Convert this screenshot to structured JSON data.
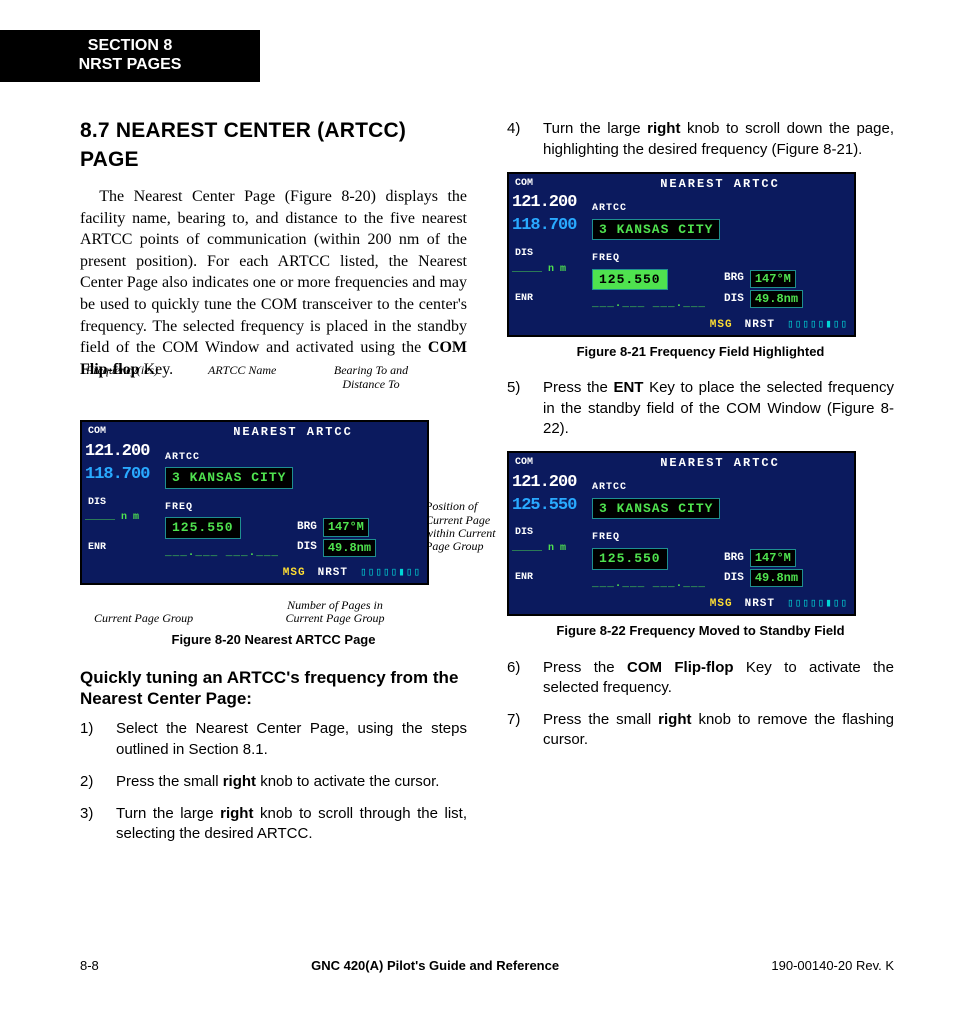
{
  "section_tab": {
    "line1": "SECTION 8",
    "line2": "NRST PAGES"
  },
  "heading": "8.7  NEAREST CENTER (ARTCC) PAGE",
  "intro": {
    "text_a": "The Nearest Center Page (Figure 8-20) displays the facility name, bearing to, and distance to the five nearest ARTCC points of communication (within 200 nm of the present position).  For each ARTCC listed, the Nearest Center Page also indicates one or more frequencies and may be used to quickly tune the COM transceiver to the center's frequency.  The selected frequency is placed in the standby field of the COM Window and activated using the ",
    "bold": "COM Flip-flop",
    "text_b": " Key."
  },
  "annotations_fig20": {
    "freq": "Frequency(ies)",
    "name": "ARTCC Name",
    "brg_dis": "Bearing To and Distance To",
    "position": "Position of Current Page within Current Page Group",
    "group": "Current Page Group",
    "numpages": "Number of Pages in Current Page Group"
  },
  "fig20": {
    "title": "NEAREST ARTCC",
    "com_label": "COM",
    "active": "121.200",
    "standby": "118.700",
    "dis_label": "DIS",
    "dis_val": "_____ n m",
    "enr_label": "ENR",
    "artcc_label": "ARTCC",
    "artcc_box": "3 KANSAS CITY",
    "freq_label": "FREQ",
    "freq_box": "125.550",
    "freq_dashes": "___.___  ___.___",
    "brg_label": "BRG",
    "brg_val": "147°M",
    "dis2_label": "DIS",
    "dis2_val": "49.8nm",
    "msg": "MSG",
    "nrst": "NRST",
    "pagebar": "▯▯▯▯▯▮▯▯",
    "caption": "Figure 8-20  Nearest ARTCC Page"
  },
  "subheading": "Quickly tuning an ARTCC's frequency from the Nearest Center Page:",
  "steps_left": [
    {
      "n": "1)",
      "a": "Select the Nearest Center Page, using the steps outlined in Section 8.1."
    },
    {
      "n": "2)",
      "a": "Press the small ",
      "b": "right",
      "c": " knob to activate the cursor."
    },
    {
      "n": "3)",
      "a": "Turn the large ",
      "b": "right",
      "c": " knob to scroll through the list, selecting the desired ARTCC."
    }
  ],
  "steps_right_4": {
    "n": "4)",
    "a": "Turn the large ",
    "b": "right",
    "c": " knob to scroll down the page, highlighting the desired frequency (Figure 8-21)."
  },
  "fig21": {
    "title": "NEAREST ARTCC",
    "com_label": "COM",
    "active": "121.200",
    "standby": "118.700",
    "dis_label": "DIS",
    "dis_val": "_____ n m",
    "enr_label": "ENR",
    "artcc_label": "ARTCC",
    "artcc_box": "3 KANSAS CITY",
    "freq_label": "FREQ",
    "freq_box_hl": "125.550",
    "freq_dashes": "___.___  ___.___",
    "brg_label": "BRG",
    "brg_val": "147°M",
    "dis2_label": "DIS",
    "dis2_val": "49.8nm",
    "msg": "MSG",
    "nrst": "NRST",
    "pagebar": "▯▯▯▯▯▮▯▯",
    "caption": "Figure 8-21  Frequency Field Highlighted"
  },
  "steps_right_5": {
    "n": "5)",
    "a": "Press the ",
    "b": "ENT",
    "c": " Key to place the selected frequency in the standby field of the COM Window (Figure 8-22)."
  },
  "fig22": {
    "title": "NEAREST ARTCC",
    "com_label": "COM",
    "active": "121.200",
    "standby": "125.550",
    "dis_label": "DIS",
    "dis_val": "_____ n m",
    "enr_label": "ENR",
    "artcc_label": "ARTCC",
    "artcc_box": "3 KANSAS CITY",
    "freq_label": "FREQ",
    "freq_box": "125.550",
    "freq_dashes": "___.___  ___.___",
    "brg_label": "BRG",
    "brg_val": "147°M",
    "dis2_label": "DIS",
    "dis2_val": "49.8nm",
    "msg": "MSG",
    "nrst": "NRST",
    "pagebar": "▯▯▯▯▯▮▯▯",
    "caption": "Figure 8-22 Frequency Moved to Standby Field"
  },
  "steps_right_6": {
    "n": "6)",
    "a": "Press the ",
    "b": "COM Flip-flop",
    "c": " Key to activate the selected frequency."
  },
  "steps_right_7": {
    "n": "7)",
    "a": "Press the small ",
    "b": "right",
    "c": " knob to remove the flashing cursor."
  },
  "footer": {
    "left": "8-8",
    "mid": "GNC 420(A) Pilot's Guide and Reference",
    "right": "190-00140-20  Rev. K"
  }
}
